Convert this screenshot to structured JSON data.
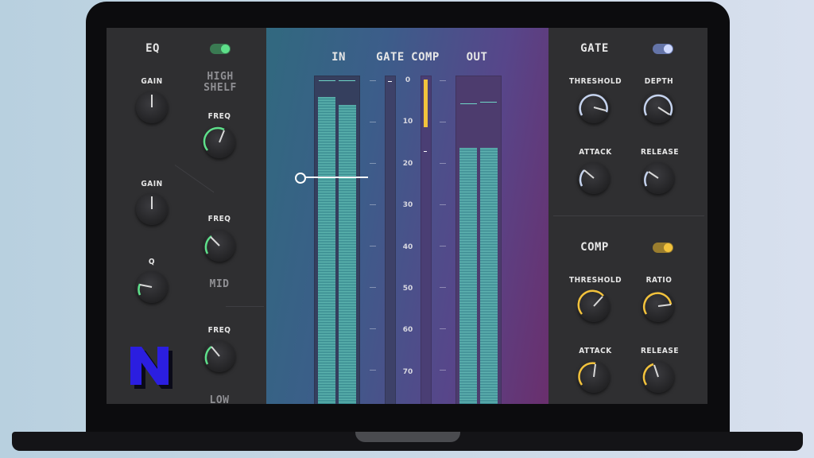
{
  "eq": {
    "title": "EQ",
    "enabled": true,
    "toggle_color": "#5ee08a",
    "accent_color": "#5ee08a",
    "bands": [
      {
        "name": "HIGH\nSHELF",
        "gain_label": "GAIN",
        "freq_label": "FREQ"
      },
      {
        "name": "MID",
        "gain_label": "GAIN",
        "q_label": "Q",
        "freq_label": "FREQ"
      },
      {
        "name": "LOW",
        "freq_label": "FREQ"
      }
    ]
  },
  "meters": {
    "in_label": "IN",
    "gate_label": "GATE",
    "comp_label": "COMP",
    "out_label": "OUT",
    "scale": [
      "0",
      "10",
      "20",
      "30",
      "40",
      "50",
      "60",
      "70"
    ],
    "meter_color": "#6fd6c7",
    "comp_reduction_color": "#f2c23c"
  },
  "gate": {
    "title": "GATE",
    "enabled": true,
    "toggle_color": "#9fb6ff",
    "accent_color": "#c5d3ee",
    "threshold_label": "THRESHOLD",
    "depth_label": "DEPTH",
    "attack_label": "ATTACK",
    "release_label": "RELEASE"
  },
  "comp": {
    "title": "COMP",
    "enabled": true,
    "toggle_color": "#f2c23c",
    "accent_color": "#f2c23c",
    "threshold_label": "THRESHOLD",
    "ratio_label": "RATIO",
    "attack_label": "ATTACK",
    "release_label": "RELEASE"
  },
  "logo": {
    "letter": "N",
    "color": "#2b1ee0"
  }
}
